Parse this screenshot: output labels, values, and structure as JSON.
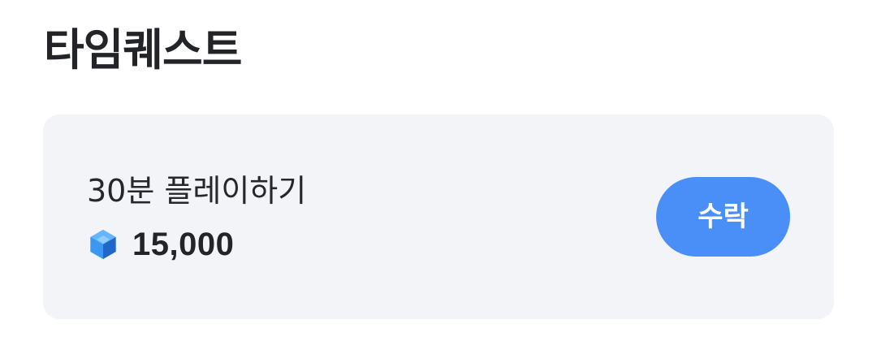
{
  "header": {
    "title": "타임퀘스트"
  },
  "quest": {
    "title": "30분 플레이하기",
    "reward_icon": "gem-icon",
    "reward_amount": "15,000",
    "accept_label": "수락"
  },
  "colors": {
    "card_background": "#f2f4f8",
    "accent": "#4a8ff7",
    "text": "#222428",
    "gem": "#3d93f0"
  }
}
